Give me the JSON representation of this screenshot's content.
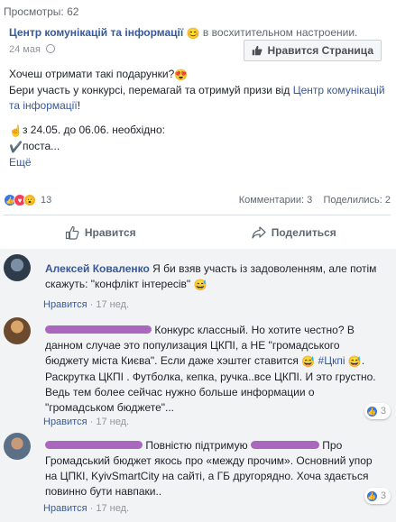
{
  "views_label": "Просмотры: 62",
  "post": {
    "page_name": "Центр комунікацій та інформації",
    "feeling": "в восхитительном настроении.",
    "date": "24 мая",
    "like_page_label": "Нравится Страница",
    "line1": "Хочеш отримати такі подарунки?",
    "line2_start": "Бери участь у конкурсі, перемагай та отримуй призи від ",
    "line2_link": "Центр комунікацій та інформації",
    "line2_end": "!",
    "line3": "з 24.05. до 06.06. необхідно:",
    "line4": "поста...",
    "more": "Ещё"
  },
  "reactions": {
    "count": "13",
    "comments": "Комментарии: 3",
    "shares": "Поделились: 2"
  },
  "actions": {
    "like": "Нравится",
    "share": "Поделиться"
  },
  "comments": [
    {
      "author": "Алексей Коваленко",
      "text": "Я би взяв участь із задоволенням, але потім скажуть: \"конфлікт інтересів\"",
      "like_label": "Нравится",
      "time": "17 нед."
    },
    {
      "text": "Конкурс классный. Но хотите честно? В данном случае это популизация ЦКПІ, а НЕ \"громадського бюджету міста Києва\". Если даже хэштег ставится ",
      "hashtag": "#Цкпі",
      "text2": ". Раскрутка ЦКПІ . Футболка, кепка, ручка..все ЦКПІ. И это грустно. Ведь тем более сейчас нужно больше информации о \"громадськом бюджете\"...",
      "like_label": "Нравится",
      "time": "17 нед.",
      "likes": "3"
    },
    {
      "text_a": "Повністю підтримую",
      "text": "Про Громадський бюджет якось про «между прочим». Основний упор на ЦПКІ, KyivSmartCity на сайті, а ГБ другорядно. Хоча здається повинно бути навпаки..",
      "like_label": "Нравится",
      "time": "17 нед.",
      "likes": "3"
    }
  ],
  "colors": {
    "link": "#385898",
    "like_blue": "#3578e5",
    "love_red": "#f33e58",
    "wow_yellow": "#f7b125",
    "comment_bg": "#f2f3f5",
    "redaction": "#9c4fb4"
  }
}
